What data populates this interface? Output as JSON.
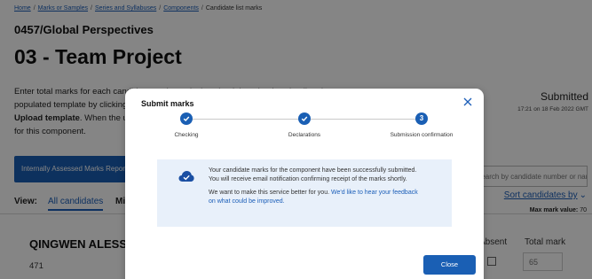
{
  "breadcrumb": {
    "items": [
      "Home",
      "Marks or Samples",
      "Series and Syllabuses",
      "Components"
    ],
    "current": "Candidate list marks",
    "separator": "/"
  },
  "page": {
    "subject": "0457/Global Perspectives",
    "title": "03 - Team Project",
    "intro_lines": [
      "Enter total marks for each candidate or alternatively upload them by downloading the pre-",
      "populated template by clicking",
      "Upload template. When the upload",
      "for this component."
    ],
    "intro_bold": "Upload template",
    "status": "Submitted",
    "status_time": "17:21 on 18 Feb 2022 GMT",
    "report_button": "Internally Assessed Marks Report",
    "search_placeholder": "Search by candidate number or name",
    "sort_link": "Sort candidates by",
    "max_mark_label": "Max mark value:",
    "max_mark_value": "70",
    "view_label": "View:",
    "view_tabs": [
      "All candidates",
      "Mi"
    ],
    "columns": {
      "absent": "Absent",
      "total": "Total mark"
    },
    "candidate": {
      "name": "QINGWEN ALESSANDRO",
      "number": "471",
      "total_placeholder": "65"
    }
  },
  "modal": {
    "title": "Submit marks",
    "steps": [
      {
        "label": "Checking",
        "state": "done"
      },
      {
        "label": "Declarations",
        "state": "done"
      },
      {
        "label": "Submission confirmation",
        "state": "current",
        "number": "3"
      }
    ],
    "message_1": "Your candidate marks for the component have been successfully submitted. You will receive email notification confirming receipt of the marks shortly.",
    "message_2_prefix": "We want to make this service better for you.",
    "feedback_link": "We'd like to hear your feedback on what could be improved.",
    "close_button": "Close"
  },
  "colors": {
    "primary": "#1a5fb4",
    "link": "#1b5eb8",
    "info_bg": "#e8f0fa",
    "overlay": "rgba(0,0,0,0.48)"
  },
  "icons": {
    "close": "close-icon",
    "step_done": "check-icon",
    "info": "cloud-check-icon",
    "sort": "chevron-down-icon"
  }
}
